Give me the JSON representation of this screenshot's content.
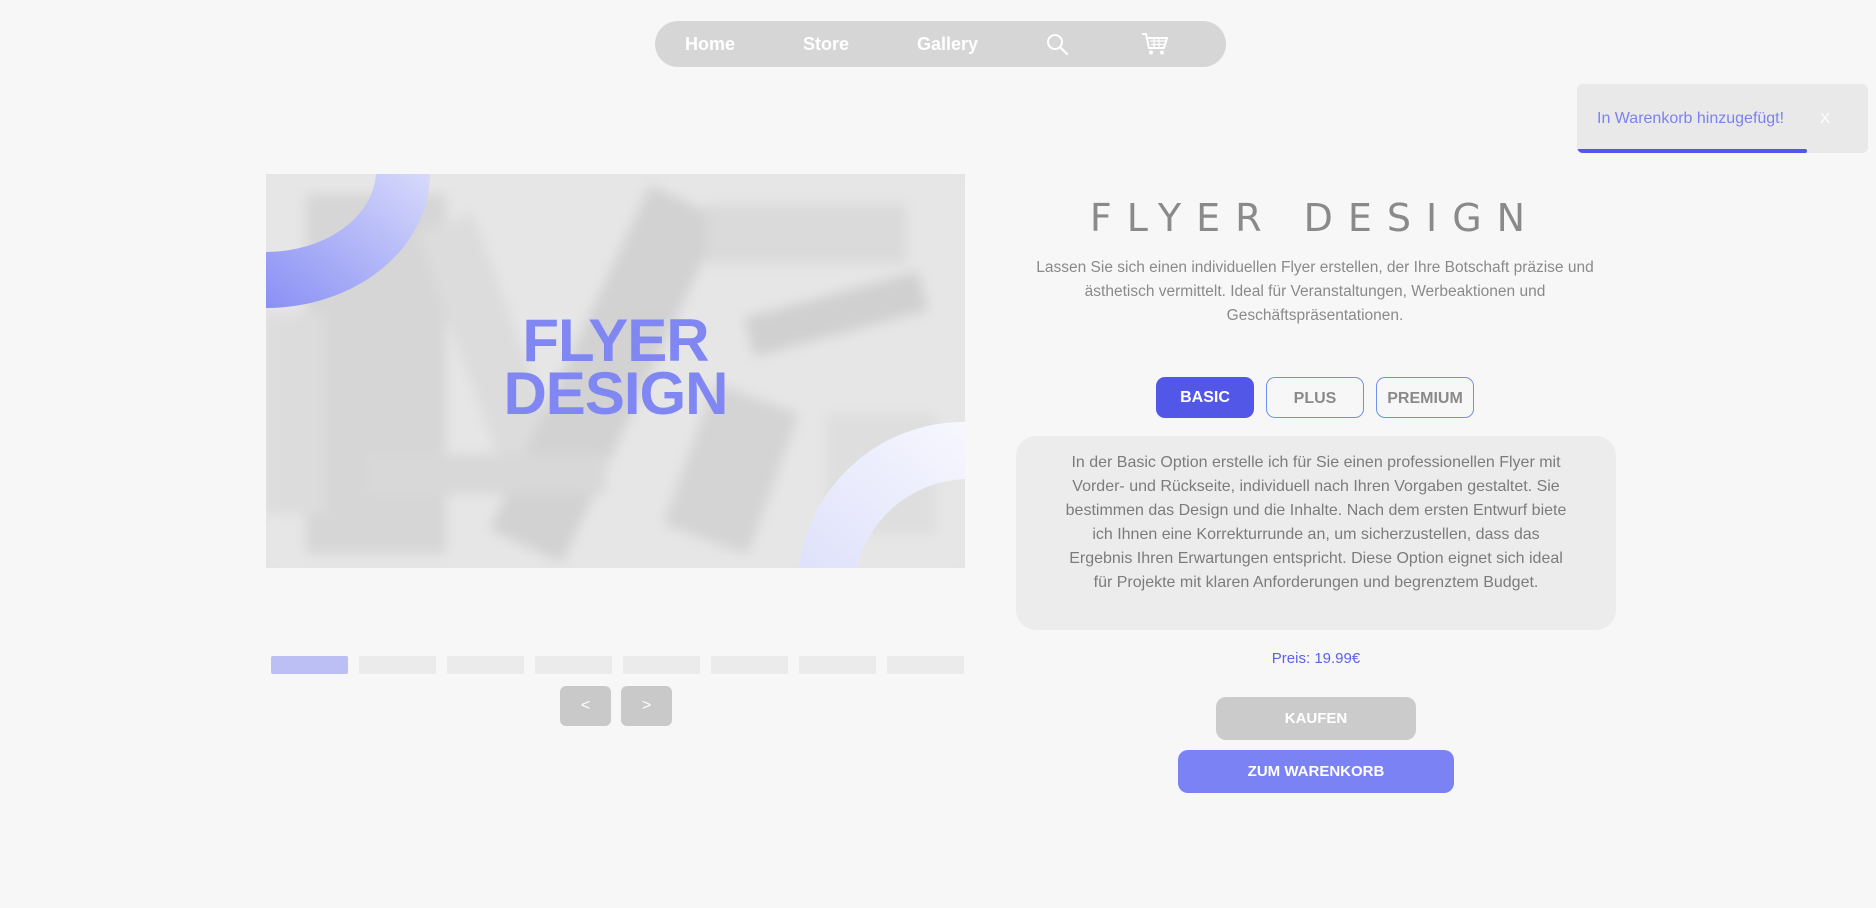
{
  "nav": {
    "items": [
      {
        "label": "Home"
      },
      {
        "label": "Store"
      },
      {
        "label": "Gallery"
      }
    ],
    "search_icon": "search-icon",
    "cart_icon": "cart-icon"
  },
  "toast": {
    "message": "In Warenkorb hinzugefügt!",
    "close_label": "X",
    "progress": 0.79
  },
  "hero": {
    "line1": "FLYER",
    "line2": "DESIGN"
  },
  "gallery": {
    "slide_count": 8,
    "active_index": 0,
    "prev_label": "<",
    "next_label": ">"
  },
  "product": {
    "title": "FLYER DESIGN",
    "description": "Lassen Sie sich einen individuellen Flyer erstellen, der Ihre Botschaft präzise und ästhetisch vermittelt. Ideal für Veranstaltungen, Werbeaktionen und Geschäftspräsentationen.",
    "options": [
      {
        "label": "BASIC",
        "selected": true
      },
      {
        "label": "PLUS",
        "selected": false
      },
      {
        "label": "PREMIUM",
        "selected": false
      }
    ],
    "option_text": "In der Basic Option erstelle ich für Sie einen professionellen Flyer mit Vorder- und Rückseite, individuell nach Ihren Vorgaben gestaltet. Sie bestimmen das Design und die Inhalte. Nach dem ersten Entwurf biete ich Ihnen eine Korrekturrunde an, um sicherzustellen, dass das Ergebnis Ihren Erwartungen entspricht. Diese Option eignet sich ideal für Projekte mit klaren Anforderungen und begrenztem Budget.",
    "price_label": "Preis:",
    "price_value": "19.99€",
    "buy_label": "KAUFEN",
    "cart_label": "ZUM WARENKORB"
  },
  "colors": {
    "accent": "#5257e8",
    "accent_light": "#7b82f3",
    "background": "#f7f7f7"
  }
}
